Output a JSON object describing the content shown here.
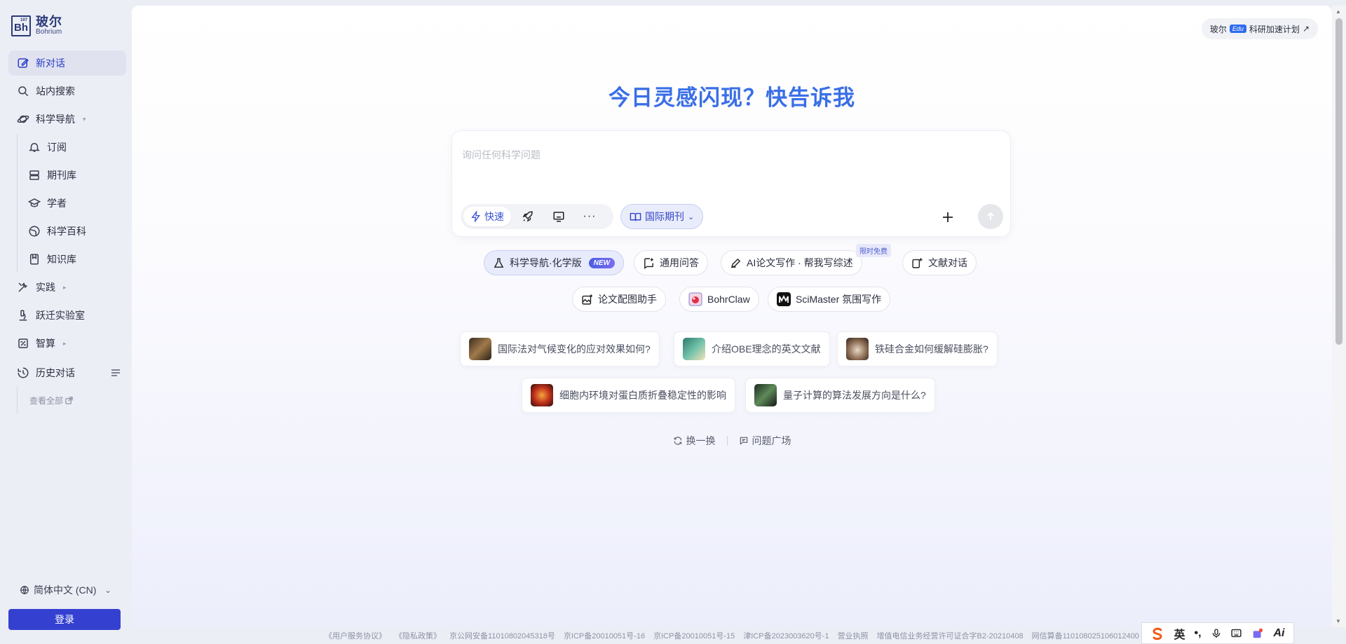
{
  "brand": {
    "logo_mark": "Bh",
    "logo_number": "107",
    "name_cn": "玻尔",
    "name_en": "Bohrium"
  },
  "sidebar": {
    "new_chat": "新对话",
    "site_search": "站内搜索",
    "science_nav": "科学导航",
    "sub_items": [
      "订阅",
      "期刊库",
      "学者",
      "科学百科",
      "知识库"
    ],
    "practice": "实践",
    "lab": "跃迁实验室",
    "compute": "智算",
    "history": "历史对话",
    "view_all": "查看全部",
    "language": "简体中文 (CN)",
    "login": "登录"
  },
  "header": {
    "edu_prefix": "玻尔",
    "edu_badge": "Edu",
    "edu_suffix": "科研加速计划",
    "edu_arrow": "↗"
  },
  "main": {
    "headline": "今日灵感闪现？快告诉我",
    "input_placeholder": "询问任何科学问题",
    "mode_fast": "快速",
    "journal_filter": "国际期刊",
    "tools": {
      "science_nav_chem": "科学导航·化学版",
      "new_badge": "NEW",
      "general_qa": "通用问答",
      "ai_writing": "AI论文写作 · 帮我写综述",
      "free_tag": "限时免费",
      "doc_chat": "文献对话",
      "figure_helper": "论文配图助手",
      "bohrclaw": "BohrClaw",
      "scimaster": "SciMaster 氛围写作"
    },
    "questions": [
      "国际法对气候变化的应对效果如何?",
      "介绍OBE理念的英文文献",
      "铁硅合金如何缓解硅膨胀?",
      "细胞内环境对蛋白质折叠稳定性的影响",
      "量子计算的算法发展方向是什么?"
    ],
    "refresh": "换一换",
    "question_square": "问题广场"
  },
  "footer": [
    "《用户服务协议》",
    "《隐私政策》",
    "京公网安备11010802045318号",
    "京ICP备20010051号-16",
    "京ICP备20010051号-15",
    "津ICP备2023003620号-1",
    "营业执照",
    "增值电信业务经营许可证合字B2-20210408",
    "网信算备110108025106012400"
  ],
  "ime": {
    "mode": "英"
  },
  "colors": {
    "accent": "#3441d0",
    "headline": "#3a6fe6",
    "sidebar_bg": "#eceef6"
  }
}
